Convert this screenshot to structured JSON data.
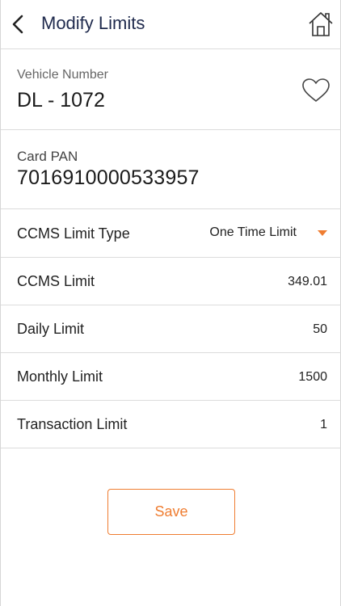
{
  "header": {
    "title": "Modify Limits",
    "back_icon": "chevron-left-icon",
    "home_icon": "home-icon"
  },
  "vehicle": {
    "label": "Vehicle Number",
    "value": "DL - 1072",
    "favorite_icon": "heart-outline-icon"
  },
  "card": {
    "label": "Card PAN",
    "value": "7016910000533957"
  },
  "limits": {
    "type_label": "CCMS Limit Type",
    "type_value": "One Time Limit",
    "ccms_label": "CCMS Limit",
    "ccms_value": "349.01",
    "daily_label": "Daily Limit",
    "daily_value": "50",
    "monthly_label": "Monthly Limit",
    "monthly_value": "1500",
    "transaction_label": "Transaction Limit",
    "transaction_value": "1"
  },
  "actions": {
    "save_label": "Save"
  },
  "colors": {
    "accent": "#ef7d31",
    "title": "#1f2a4d",
    "divider": "#dcdcdc"
  }
}
